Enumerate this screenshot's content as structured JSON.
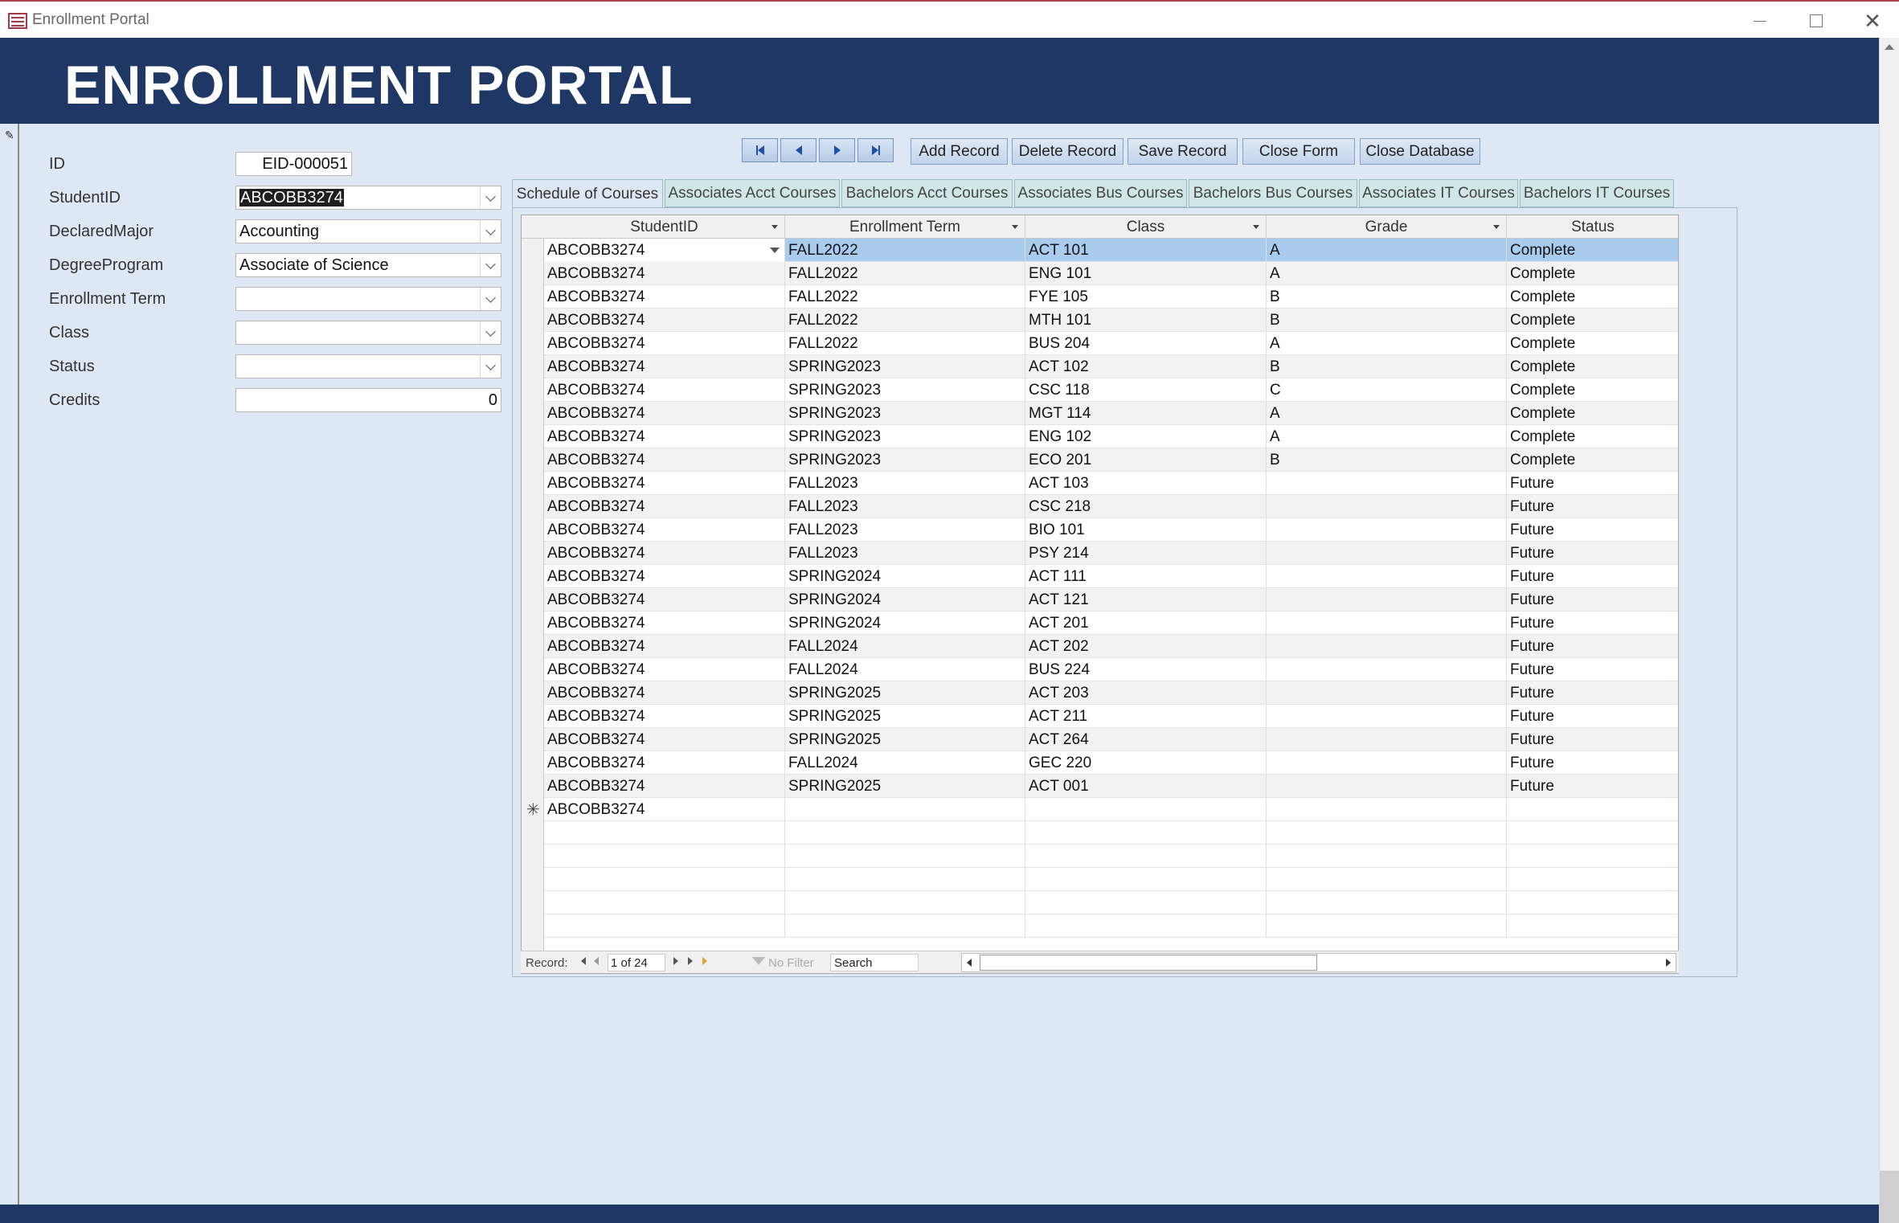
{
  "window": {
    "title": "Enrollment Portal"
  },
  "header": {
    "title": "ENROLLMENT PORTAL"
  },
  "form": {
    "labels": {
      "id": "ID",
      "student_id": "StudentID",
      "declared_major": "DeclaredMajor",
      "degree_program": "DegreeProgram",
      "enrollment_term": "Enrollment Term",
      "class": "Class",
      "status": "Status",
      "credits": "Credits"
    },
    "values": {
      "id": "EID-000051",
      "student_id": "ABCOBB3274",
      "declared_major": "Accounting",
      "degree_program": "Associate of Science",
      "enrollment_term": "",
      "class": "",
      "status": "",
      "credits": "0"
    }
  },
  "toolbar": {
    "add_record": "Add Record",
    "delete_record": "Delete Record",
    "save_record": "Save Record",
    "close_form": "Close Form",
    "close_database": "Close Database"
  },
  "tabs": [
    "Schedule of Courses",
    "Associates Acct Courses",
    "Bachelors Acct Courses",
    "Associates Bus Courses",
    "Bachelors Bus Courses",
    "Associates IT Courses",
    "Bachelors IT Courses"
  ],
  "active_tab": 0,
  "datasheet": {
    "columns": [
      "StudentID",
      "Enrollment Term",
      "Class",
      "Grade",
      "Status"
    ],
    "rows": [
      [
        "ABCOBB3274",
        "FALL2022",
        "ACT 101",
        "A",
        "Complete"
      ],
      [
        "ABCOBB3274",
        "FALL2022",
        "ENG 101",
        "A",
        "Complete"
      ],
      [
        "ABCOBB3274",
        "FALL2022",
        "FYE 105",
        "B",
        "Complete"
      ],
      [
        "ABCOBB3274",
        "FALL2022",
        "MTH 101",
        "B",
        "Complete"
      ],
      [
        "ABCOBB3274",
        "FALL2022",
        "BUS 204",
        "A",
        "Complete"
      ],
      [
        "ABCOBB3274",
        "SPRING2023",
        "ACT 102",
        "B",
        "Complete"
      ],
      [
        "ABCOBB3274",
        "SPRING2023",
        "CSC 118",
        "C",
        "Complete"
      ],
      [
        "ABCOBB3274",
        "SPRING2023",
        "MGT 114",
        "A",
        "Complete"
      ],
      [
        "ABCOBB3274",
        "SPRING2023",
        "ENG 102",
        "A",
        "Complete"
      ],
      [
        "ABCOBB3274",
        "SPRING2023",
        "ECO 201",
        "B",
        "Complete"
      ],
      [
        "ABCOBB3274",
        "FALL2023",
        "ACT 103",
        "",
        "Future"
      ],
      [
        "ABCOBB3274",
        "FALL2023",
        "CSC 218",
        "",
        "Future"
      ],
      [
        "ABCOBB3274",
        "FALL2023",
        "BIO 101",
        "",
        "Future"
      ],
      [
        "ABCOBB3274",
        "FALL2023",
        "PSY 214",
        "",
        "Future"
      ],
      [
        "ABCOBB3274",
        "SPRING2024",
        "ACT 111",
        "",
        "Future"
      ],
      [
        "ABCOBB3274",
        "SPRING2024",
        "ACT 121",
        "",
        "Future"
      ],
      [
        "ABCOBB3274",
        "SPRING2024",
        "ACT 201",
        "",
        "Future"
      ],
      [
        "ABCOBB3274",
        "FALL2024",
        "ACT 202",
        "",
        "Future"
      ],
      [
        "ABCOBB3274",
        "FALL2024",
        "BUS 224",
        "",
        "Future"
      ],
      [
        "ABCOBB3274",
        "SPRING2025",
        "ACT 203",
        "",
        "Future"
      ],
      [
        "ABCOBB3274",
        "SPRING2025",
        "ACT 211",
        "",
        "Future"
      ],
      [
        "ABCOBB3274",
        "SPRING2025",
        "ACT 264",
        "",
        "Future"
      ],
      [
        "ABCOBB3274",
        "FALL2024",
        "GEC 220",
        "",
        "Future"
      ],
      [
        "ABCOBB3274",
        "SPRING2025",
        "ACT 001",
        "",
        "Future"
      ]
    ],
    "new_row_student_id": "ABCOBB3274",
    "new_row_marker": "✳"
  },
  "record_nav": {
    "label": "Record:",
    "position": "1 of 24",
    "filter": "No Filter",
    "search": "Search"
  },
  "colors": {
    "header_band": "#1e3764",
    "background": "#dde8f4",
    "selected_row": "#a9cbee",
    "tab_inactive": "#d1e6e8"
  }
}
